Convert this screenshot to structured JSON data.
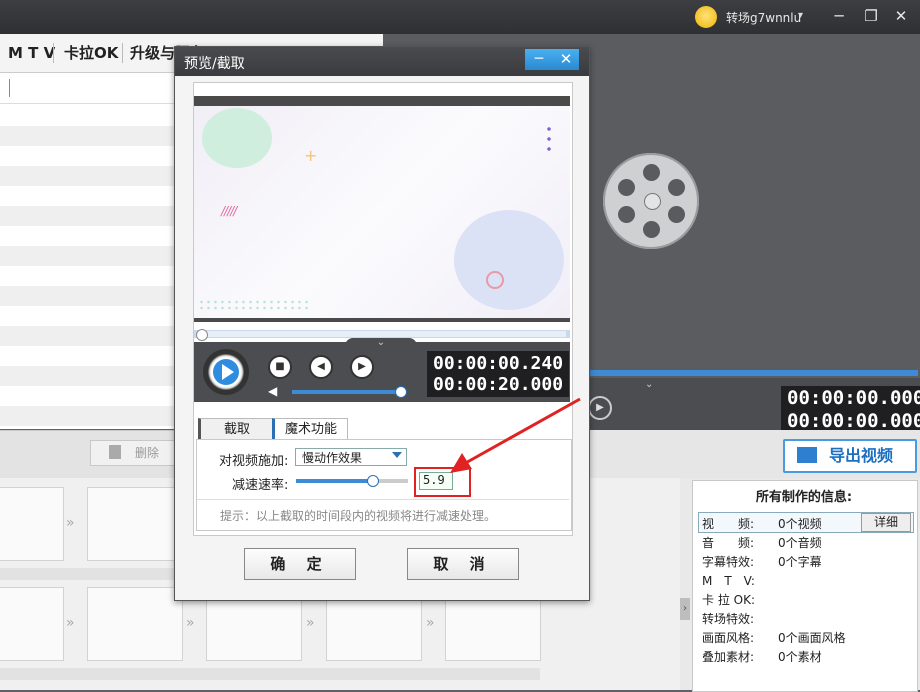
{
  "topbar": {
    "user_name": "转场g7wnnlu",
    "caret": "▾",
    "min_icon": "─",
    "restore_icon": "❐",
    "close_icon": "✕"
  },
  "left_tabs": [
    "M T V",
    "卡拉OK",
    "升级与服务"
  ],
  "left_footer": {
    "delete_label": "删除"
  },
  "dialog": {
    "title": "预览/截取",
    "min_label": "─",
    "close_label": "✕",
    "time_current": "00:00:00.240",
    "time_total": "00:00:20.000",
    "tabs": [
      "截取",
      "魔术功能"
    ],
    "effect_label": "对视频施加:",
    "effect_value": "慢动作效果",
    "speed_label": "减速速率:",
    "speed_value": "5.9",
    "hint": "提示：以上截取的时间段内的视频将进行减速处理。",
    "ok_label": "确 定",
    "cancel_label": "取 消"
  },
  "right_panel": {
    "time_current": "00:00:00.000",
    "time_total": "00:00:00.000",
    "export_label": "导出视频"
  },
  "info": {
    "title": "所有制作的信息:",
    "detail_label": "详细",
    "rows": [
      {
        "label": "视　　频:",
        "value": "0个视频"
      },
      {
        "label": "音　　频:",
        "value": "0个音频"
      },
      {
        "label": "字幕特效:",
        "value": "0个字幕"
      },
      {
        "label": "M　T　V:",
        "value": ""
      },
      {
        "label": "卡 拉 OK:",
        "value": ""
      },
      {
        "label": "转场特效:",
        "value": ""
      },
      {
        "label": "画面风格:",
        "value": "0个画面风格"
      },
      {
        "label": "叠加素材:",
        "value": "0个素材"
      }
    ]
  },
  "icons": [
    "avatar-icon",
    "play-icon",
    "stop-icon",
    "prev-frame-icon",
    "next-frame-icon",
    "volume-icon",
    "trash-icon",
    "film-reel-icon",
    "export-icon"
  ],
  "colors": {
    "accent_blue": "#3d8bd4",
    "highlight_red": "#e02222"
  }
}
